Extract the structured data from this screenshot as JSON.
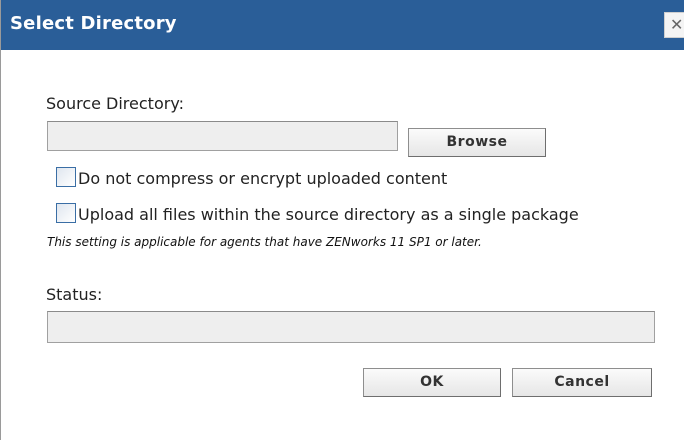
{
  "dialog": {
    "title": "Select Directory",
    "close_glyph": "✕"
  },
  "source": {
    "label": "Source Directory:",
    "value": "",
    "browse_label": "Browse"
  },
  "options": {
    "no_compress_label": "Do not compress or encrypt uploaded content",
    "no_compress_checked": false,
    "single_package_label": "Upload all files within the source directory as a single package",
    "single_package_checked": false,
    "note": "This setting is applicable for agents that have ZENworks 11 SP1 or later."
  },
  "status": {
    "label": "Status:",
    "value": ""
  },
  "footer": {
    "ok_label": "OK",
    "cancel_label": "Cancel"
  },
  "colors": {
    "titlebar": "#2a5e98",
    "checkbox_border": "#3a6ea5"
  },
  "icons": {
    "close": "close-icon"
  }
}
